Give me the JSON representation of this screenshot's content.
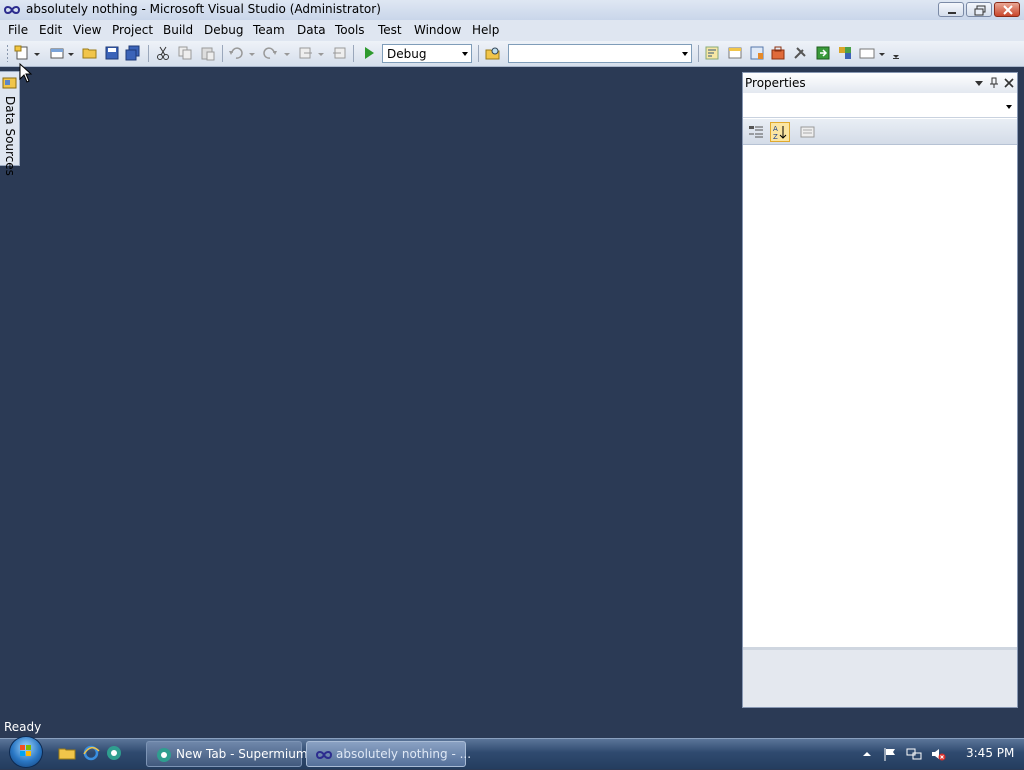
{
  "window": {
    "title": "absolutely nothing - Microsoft Visual Studio (Administrator)",
    "icon": "visual-studio-icon"
  },
  "menu": {
    "items": [
      "File",
      "Edit",
      "View",
      "Project",
      "Build",
      "Debug",
      "Team",
      "Data",
      "Tools",
      "Test",
      "Window",
      "Help"
    ]
  },
  "toolbar": {
    "configuration": "Debug",
    "platform": "",
    "colors": {
      "accent": "#2b3a55"
    }
  },
  "side_tab": {
    "label": "Data Sources"
  },
  "properties": {
    "title": "Properties",
    "object_selector": ""
  },
  "status": {
    "text": "Ready"
  },
  "taskbar": {
    "tasks": [
      {
        "label": "New Tab - Supermium",
        "icon": "supermium-icon"
      },
      {
        "label": "absolutely nothing - ...",
        "icon": "visual-studio-icon"
      }
    ],
    "clock": "3:45 PM"
  }
}
